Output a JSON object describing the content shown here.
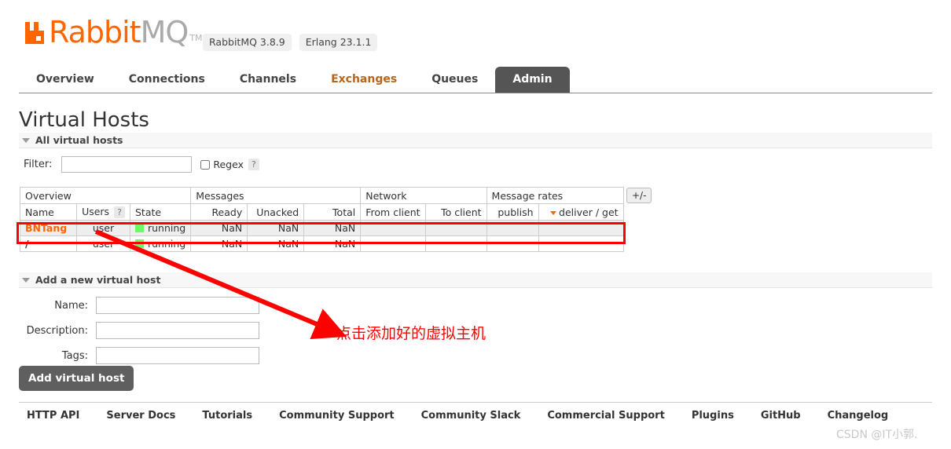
{
  "header": {
    "logo_rabbit": "Rabbit",
    "logo_mq": "MQ",
    "logo_tm": "TM",
    "badges": [
      "RabbitMQ 3.8.9",
      "Erlang 23.1.1"
    ],
    "accent_color": "#FF6600"
  },
  "nav": {
    "items": [
      {
        "label": "Overview",
        "active": false
      },
      {
        "label": "Connections",
        "active": false
      },
      {
        "label": "Channels",
        "active": false
      },
      {
        "label": "Exchanges",
        "active": false
      },
      {
        "label": "Queues",
        "active": false
      },
      {
        "label": "Admin",
        "active": true
      }
    ]
  },
  "page": {
    "title": "Virtual Hosts"
  },
  "all_hosts_section": {
    "header": "All virtual hosts",
    "filter": {
      "label": "Filter:",
      "value": "",
      "placeholder": "",
      "regex_label": "Regex",
      "regex_checked": false,
      "help": "?"
    },
    "plusminus": "+/-",
    "group_headers": [
      "Overview",
      "Messages",
      "Network",
      "Message rates"
    ],
    "columns": [
      {
        "label": "Name",
        "sortable": true
      },
      {
        "label": "Users",
        "sortable": false,
        "help": "?"
      },
      {
        "label": "State",
        "sortable": false
      },
      {
        "label": "Ready",
        "sortable": true
      },
      {
        "label": "Unacked",
        "sortable": true
      },
      {
        "label": "Total",
        "sortable": true
      },
      {
        "label": "From client",
        "sortable": true
      },
      {
        "label": "To client",
        "sortable": true
      },
      {
        "label": "publish",
        "sortable": true
      },
      {
        "label": "deliver / get",
        "sortable": true,
        "sorted": "desc"
      }
    ],
    "rows": [
      {
        "name": "BNTang",
        "users": "user",
        "state": "running",
        "ready": "NaN",
        "unacked": "NaN",
        "total": "NaN",
        "from_client": "",
        "to_client": "",
        "publish": "",
        "deliver_get": "",
        "highlighted": true
      },
      {
        "name": "/",
        "users": "user",
        "state": "running",
        "ready": "NaN",
        "unacked": "NaN",
        "total": "NaN",
        "from_client": "",
        "to_client": "",
        "publish": "",
        "deliver_get": "",
        "highlighted": false
      }
    ]
  },
  "add_host_section": {
    "header": "Add a new virtual host",
    "fields": [
      {
        "label": "Name:",
        "value": ""
      },
      {
        "label": "Description:",
        "value": ""
      },
      {
        "label": "Tags:",
        "value": ""
      }
    ],
    "submit_label": "Add virtual host"
  },
  "annotation": {
    "text": "点击添加好的虚拟主机",
    "color": "#FF0000"
  },
  "footer": {
    "links": [
      "HTTP API",
      "Server Docs",
      "Tutorials",
      "Community Support",
      "Community Slack",
      "Commercial Support",
      "Plugins",
      "GitHub",
      "Changelog"
    ]
  },
  "watermark": "CSDN @IT小郭."
}
